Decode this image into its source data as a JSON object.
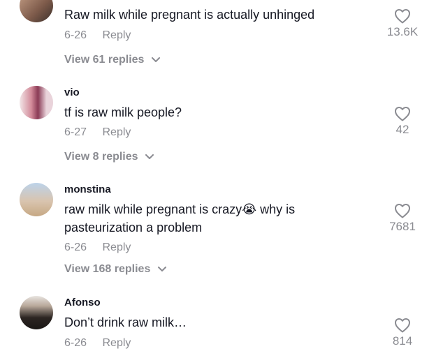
{
  "comments": [
    {
      "username": "",
      "text": "Raw milk while pregnant is actually unhinged",
      "date": "6-26",
      "reply_label": "Reply",
      "likes": "13.6K",
      "view_replies": "View 61 replies"
    },
    {
      "username": "vio",
      "text": "tf is raw milk people?",
      "date": "6-27",
      "reply_label": "Reply",
      "likes": "42",
      "view_replies": "View 8 replies"
    },
    {
      "username": "monstina",
      "text": "raw milk while pregnant is crazy😭 why is pasteurization a problem",
      "date": "6-26",
      "reply_label": "Reply",
      "likes": "7681",
      "view_replies": "View 168 replies"
    },
    {
      "username": "Afonso",
      "text": "Don’t drink raw milk…",
      "date": "6-26",
      "reply_label": "Reply",
      "likes": "814",
      "view_replies": ""
    }
  ],
  "colors": {
    "text": "#161823",
    "secondary": "#8a8b91",
    "background": "#ffffff"
  },
  "icons": {
    "like": "heart-outline-icon",
    "expand": "chevron-down-icon"
  }
}
